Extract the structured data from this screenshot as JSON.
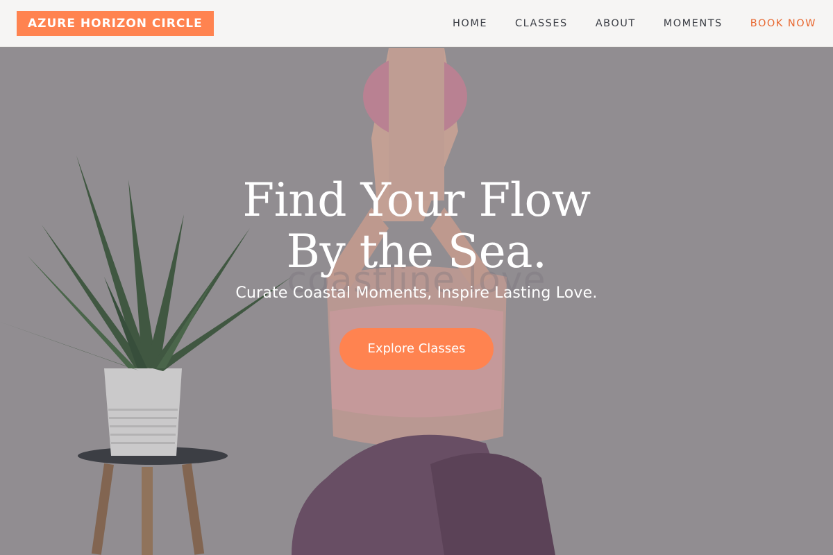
{
  "brand": {
    "name": "AZURE HORIZON CIRCLE",
    "accent_color": "#ff8350"
  },
  "nav": {
    "items": [
      {
        "label": "HOME"
      },
      {
        "label": "CLASSES"
      },
      {
        "label": "ABOUT"
      },
      {
        "label": "MOMENTS"
      }
    ],
    "cta_label": "BOOK NOW"
  },
  "hero": {
    "headline_line1": "Find Your Flow",
    "headline_line2": "By the Sea.",
    "watermark": "coastline love",
    "tagline": "Curate Coastal Moments, Inspire Lasting Love.",
    "button_label": "Explore Classes",
    "background_image": "yoga-woman-aloe-plant-stool"
  }
}
